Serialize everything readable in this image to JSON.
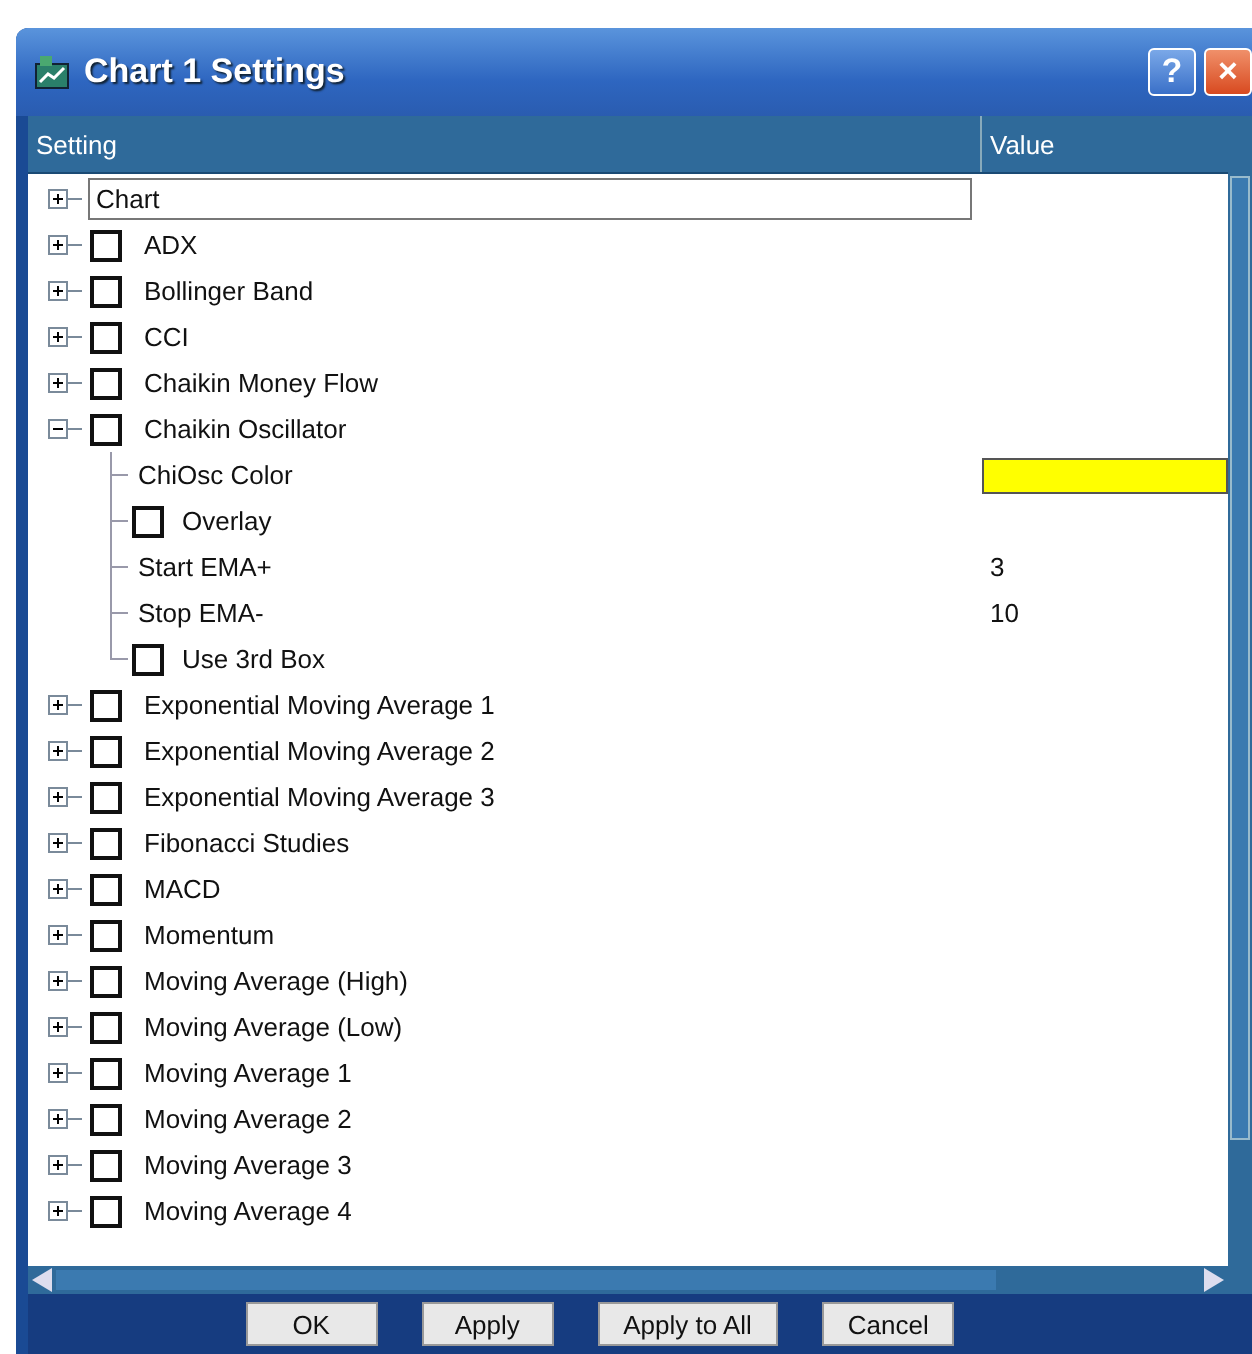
{
  "window": {
    "title": "Chart 1 Settings",
    "help_button": "?",
    "close_button": "×"
  },
  "table": {
    "columns": [
      "Setting",
      "Value"
    ],
    "items": [
      {
        "kind": "folder",
        "label": "Chart",
        "expanded": false,
        "selected": true
      },
      {
        "kind": "toggle",
        "label": "ADX",
        "expanded": false,
        "checked": false,
        "selected": false
      },
      {
        "kind": "toggle",
        "label": "Bollinger Band",
        "expanded": false,
        "checked": false,
        "selected": false
      },
      {
        "kind": "toggle",
        "label": "CCI",
        "expanded": false,
        "checked": false,
        "selected": false
      },
      {
        "kind": "toggle",
        "label": "Chaikin Money Flow",
        "expanded": false,
        "checked": false,
        "selected": false
      },
      {
        "kind": "toggle",
        "label": "Chaikin Oscillator",
        "expanded": true,
        "checked": false,
        "selected": false,
        "children": [
          {
            "kind": "color",
            "label": "ChiOsc Color",
            "color": "#ffff00"
          },
          {
            "kind": "checkbox",
            "label": "Overlay",
            "checked": false
          },
          {
            "kind": "number",
            "label": "Start EMA+",
            "value": "3"
          },
          {
            "kind": "number",
            "label": "Stop EMA-",
            "value": "10"
          },
          {
            "kind": "checkbox",
            "label": "Use 3rd Box",
            "checked": false
          }
        ]
      },
      {
        "kind": "toggle",
        "label": "Exponential Moving Average 1",
        "expanded": false,
        "checked": false,
        "selected": false
      },
      {
        "kind": "toggle",
        "label": "Exponential Moving Average 2",
        "expanded": false,
        "checked": false,
        "selected": false
      },
      {
        "kind": "toggle",
        "label": "Exponential Moving Average 3",
        "expanded": false,
        "checked": false,
        "selected": false
      },
      {
        "kind": "toggle",
        "label": "Fibonacci Studies",
        "expanded": false,
        "checked": false,
        "selected": false
      },
      {
        "kind": "toggle",
        "label": "MACD",
        "expanded": false,
        "checked": false,
        "selected": false
      },
      {
        "kind": "toggle",
        "label": "Momentum",
        "expanded": false,
        "checked": false,
        "selected": false
      },
      {
        "kind": "toggle",
        "label": "Moving Average (High)",
        "expanded": false,
        "checked": false,
        "selected": false
      },
      {
        "kind": "toggle",
        "label": "Moving Average (Low)",
        "expanded": false,
        "checked": false,
        "selected": false
      },
      {
        "kind": "toggle",
        "label": "Moving Average 1",
        "expanded": false,
        "checked": false,
        "selected": false
      },
      {
        "kind": "toggle",
        "label": "Moving Average 2",
        "expanded": false,
        "checked": false,
        "selected": false
      },
      {
        "kind": "toggle",
        "label": "Moving Average 3",
        "expanded": false,
        "checked": false,
        "selected": false
      },
      {
        "kind": "toggle",
        "label": "Moving Average 4",
        "expanded": false,
        "checked": false,
        "selected": false
      }
    ]
  },
  "buttons": [
    "OK",
    "Apply",
    "Apply to All",
    "Cancel"
  ]
}
